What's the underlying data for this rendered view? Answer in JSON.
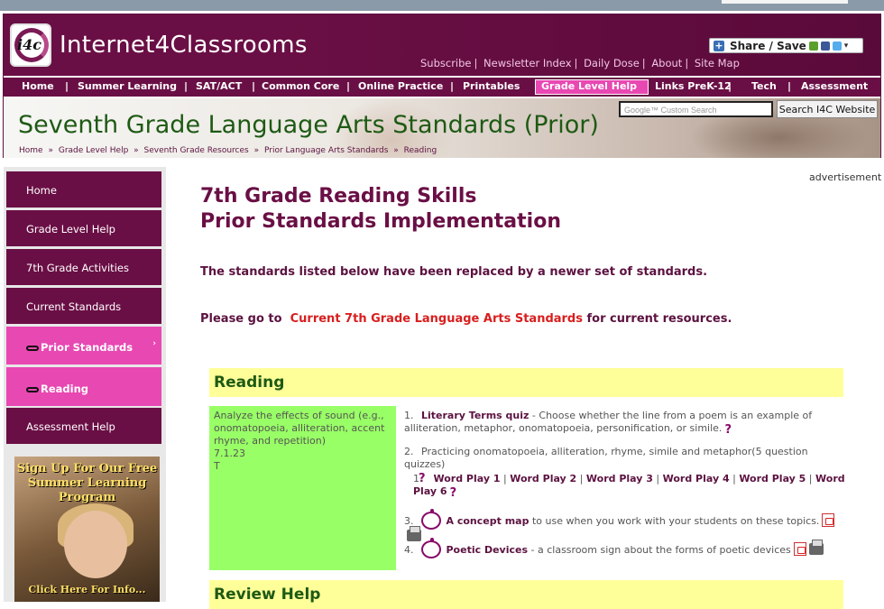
{
  "header": {
    "site_name": "Internet4Classrooms",
    "logo_text": "i4c",
    "top_links": [
      "Subscribe",
      "Newsletter Index",
      "Daily Dose",
      "About",
      "Site Map"
    ],
    "share_label": "Share / Save"
  },
  "nav": {
    "items": [
      "Home",
      "Summer Learning",
      "SAT/ACT",
      "Common Core",
      "Online Practice",
      "Printables",
      "Grade Level Help",
      "Links PreK-12",
      "Tech",
      "Assessment"
    ],
    "active": "Grade Level Help"
  },
  "banner": {
    "title": "Seventh Grade Language Arts Standards (Prior)",
    "breadcrumb": [
      "Home",
      "»",
      "Grade Level Help",
      "»",
      "Seventh Grade Resources",
      "»",
      "Prior Language Arts Standards",
      "»",
      "Reading"
    ],
    "search_placeholder": "Google™ Custom Search",
    "search_button": "Search I4C Website"
  },
  "sidebar": {
    "items": [
      {
        "label": "Home"
      },
      {
        "label": "Grade Level Help"
      },
      {
        "label": "7th Grade Activities"
      },
      {
        "label": "Current Standards"
      },
      {
        "label": "Prior Standards"
      },
      {
        "label": "Reading"
      },
      {
        "label": "Assessment Help"
      }
    ],
    "promo_text": "Sign Up For Our Free Summer Learning Program",
    "promo_cta": "Click Here For Info..."
  },
  "main": {
    "ad_label": "advertisement",
    "heading_line1": "7th Grade Reading Skills",
    "heading_line2": "Prior Standards Implementation",
    "notice": "The standards listed below have been replaced by a newer set of standards.",
    "goto_prefix": "Please go to",
    "goto_link": "Current 7th Grade Language Arts Standards",
    "goto_suffix": "for current resources.",
    "section_reading": "Reading",
    "section_review": "Review Help",
    "standard_text": "Analyze the effects of sound (e.g., onomatopoeia, alliteration, accent rhyme, and repetition)",
    "standard_code": "7.1.23",
    "standard_code2": "T",
    "resources": {
      "r1_num": "1.",
      "r1_link": "Literary Terms quiz",
      "r1_desc": "- Choose whether the line from a poem is an example of alliteration, metaphor, onomatopoeia, personification, or simile.",
      "r2_num": "2.",
      "r2_desc": "Practicing onomatopoeia, alliteration, rhyme, simile and metaphor",
      "r2_note": "(5 question quizzes)",
      "sub_num": "1.",
      "word_play": [
        "Word Play 1",
        "Word Play 2",
        "Word Play 3",
        "Word Play 4",
        "Word Play 5",
        "Word Play 6"
      ],
      "r3_num": "3.",
      "r3_link": "A concept map",
      "r3_desc": "to use when you work with your students on these topics.",
      "r4_num": "4.",
      "r4_link": "Poetic Devices",
      "r4_desc": "- a classroom sign about the forms of poetic devices"
    }
  }
}
